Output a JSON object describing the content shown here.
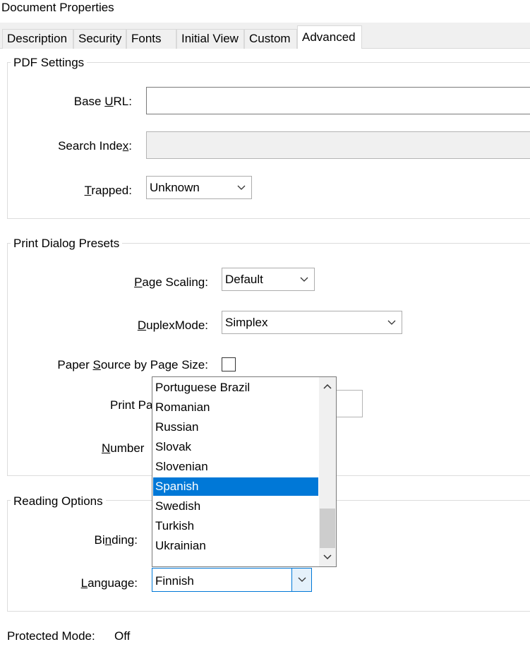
{
  "window": {
    "title": "Document Properties"
  },
  "tabs": [
    {
      "label": "Description",
      "active": false
    },
    {
      "label": "Security",
      "active": false
    },
    {
      "label": "Fonts",
      "active": false
    },
    {
      "label": "Initial View",
      "active": false
    },
    {
      "label": "Custom",
      "active": false
    },
    {
      "label": "Advanced",
      "active": true
    }
  ],
  "pdf_settings": {
    "legend": "PDF Settings",
    "base_url": {
      "label_pre": "Base ",
      "label_u": "U",
      "label_post": "RL:",
      "value": ""
    },
    "search_index": {
      "label_pre": "Search Inde",
      "label_u": "x",
      "label_post": ":",
      "value": ""
    },
    "trapped": {
      "label_u": "T",
      "label_post": "rapped:",
      "value": "Unknown"
    }
  },
  "print_presets": {
    "legend": "Print Dialog Presets",
    "page_scaling": {
      "label_u": "P",
      "label_post": "age Scaling:",
      "value": "Default"
    },
    "duplex_mode": {
      "label_u": "D",
      "label_post": "uplexMode:",
      "value": "Simplex"
    },
    "paper_source": {
      "label_pre": "Paper ",
      "label_u": "S",
      "label_post": "ource by Page Size:",
      "checked": false
    },
    "print_range_partial": "Print Pa",
    "number_copies_partial_u": "N",
    "number_copies_partial": "umber"
  },
  "reading_options": {
    "legend": "Reading Options",
    "binding": {
      "label_pre": "Bi",
      "label_u": "n",
      "label_post": "ding:"
    },
    "language": {
      "label_u": "L",
      "label_post": "anguage:",
      "value": "Finnish"
    }
  },
  "language_dropdown": {
    "options": [
      "Portuguese Brazil",
      "Romanian",
      "Russian",
      "Slovak",
      "Slovenian",
      "Spanish",
      "Swedish",
      "Turkish",
      "Ukrainian"
    ],
    "highlighted": "Spanish"
  },
  "protected_mode": {
    "label": "Protected Mode:",
    "value": "Off"
  },
  "icons": {
    "chevron_down": "chevron-down-icon",
    "chevron_up": "chevron-up-icon"
  }
}
